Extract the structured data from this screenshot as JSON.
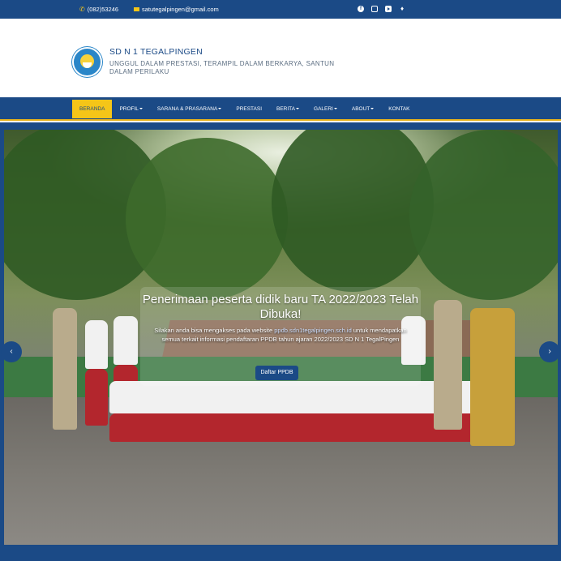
{
  "topbar": {
    "phone": "(082)53246",
    "email": "satutegalpingen@gmail.com",
    "social": [
      "facebook-icon",
      "instagram-icon",
      "youtube-icon",
      "twitter-icon"
    ]
  },
  "header": {
    "title": "SD N 1 TEGALPINGEN",
    "tagline": "UNGGUL DALAM PRESTASI, TERAMPIL DALAM BERKARYA, SANTUN DALAM PERILAKU"
  },
  "nav": {
    "items": [
      {
        "label": "BERANDA",
        "active": true,
        "dropdown": false
      },
      {
        "label": "PROFIL",
        "active": false,
        "dropdown": true
      },
      {
        "label": "SARANA & PRASARANA",
        "active": false,
        "dropdown": true
      },
      {
        "label": "PRESTASI",
        "active": false,
        "dropdown": false
      },
      {
        "label": "BERITA",
        "active": false,
        "dropdown": true
      },
      {
        "label": "GALERI",
        "active": false,
        "dropdown": true
      },
      {
        "label": "ABOUT",
        "active": false,
        "dropdown": true
      },
      {
        "label": "KONTAK",
        "active": false,
        "dropdown": false
      }
    ]
  },
  "hero": {
    "title": "Penerimaan peserta didik baru TA 2022/2023 Telah Dibuka!",
    "text_before": "Silakan anda bisa mengakses pada website ",
    "link": "ppdb.sdn1tegalpingen.sch.id",
    "text_after": " untuk mendapatkan semua terkait informasi pendaftaran PPDB tahun ajaran 2022/2023 SD N 1 TegalPingen",
    "button": "Daftar PPDB"
  },
  "colors": {
    "primary": "#1b4a86",
    "accent": "#f5c518"
  }
}
